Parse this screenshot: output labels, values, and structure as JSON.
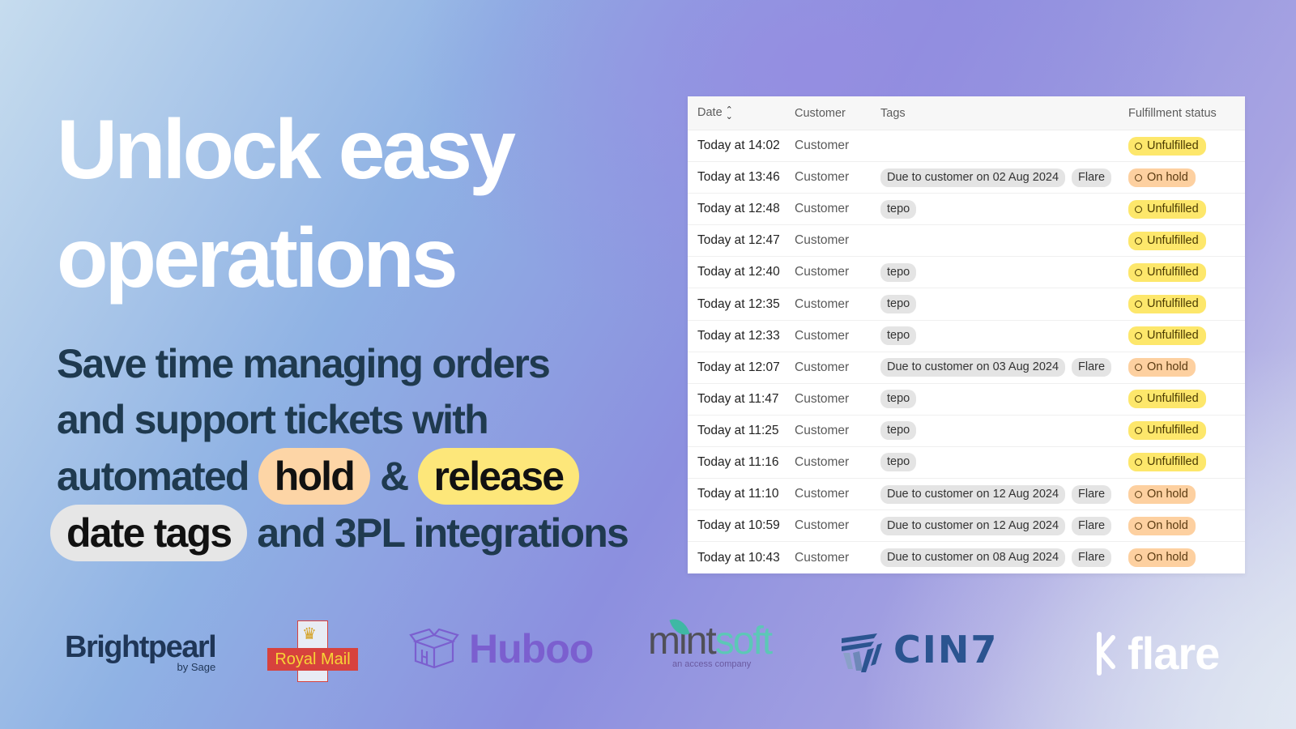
{
  "hero": {
    "title_line1": "Unlock easy",
    "title_line2": "operations"
  },
  "subtitle": {
    "line1": "Save time managing orders",
    "line2": "and support tickets with",
    "automated": "automated",
    "hold": "hold",
    "amp": "&",
    "release": "release",
    "date_tags": "date tags",
    "rest": "and 3PL integrations"
  },
  "table": {
    "headers": {
      "date": "Date",
      "customer": "Customer",
      "tags": "Tags",
      "status": "Fulfillment status"
    },
    "rows": [
      {
        "date": "Today at 14:02",
        "customer": "Customer",
        "tags": [],
        "status": "Unfulfilled"
      },
      {
        "date": "Today at 13:46",
        "customer": "Customer",
        "tags": [
          "Due to customer on 02 Aug 2024",
          "Flare"
        ],
        "status": "On hold"
      },
      {
        "date": "Today at 12:48",
        "customer": "Customer",
        "tags": [
          "tepo"
        ],
        "status": "Unfulfilled"
      },
      {
        "date": "Today at 12:47",
        "customer": "Customer",
        "tags": [],
        "status": "Unfulfilled"
      },
      {
        "date": "Today at 12:40",
        "customer": "Customer",
        "tags": [
          "tepo"
        ],
        "status": "Unfulfilled"
      },
      {
        "date": "Today at 12:35",
        "customer": "Customer",
        "tags": [
          "tepo"
        ],
        "status": "Unfulfilled"
      },
      {
        "date": "Today at 12:33",
        "customer": "Customer",
        "tags": [
          "tepo"
        ],
        "status": "Unfulfilled"
      },
      {
        "date": "Today at 12:07",
        "customer": "Customer",
        "tags": [
          "Due to customer on 03 Aug 2024",
          "Flare"
        ],
        "status": "On hold"
      },
      {
        "date": "Today at 11:47",
        "customer": "Customer",
        "tags": [
          "tepo"
        ],
        "status": "Unfulfilled"
      },
      {
        "date": "Today at 11:25",
        "customer": "Customer",
        "tags": [
          "tepo"
        ],
        "status": "Unfulfilled"
      },
      {
        "date": "Today at 11:16",
        "customer": "Customer",
        "tags": [
          "tepo"
        ],
        "status": "Unfulfilled"
      },
      {
        "date": "Today at 11:10",
        "customer": "Customer",
        "tags": [
          "Due to customer on 12 Aug 2024",
          "Flare"
        ],
        "status": "On hold"
      },
      {
        "date": "Today at 10:59",
        "customer": "Customer",
        "tags": [
          "Due to customer on 12 Aug 2024",
          "Flare"
        ],
        "status": "On hold"
      },
      {
        "date": "Today at 10:43",
        "customer": "Customer",
        "tags": [
          "Due to customer on 08 Aug 2024",
          "Flare"
        ],
        "status": "On hold"
      }
    ]
  },
  "status_colors": {
    "Unfulfilled": "#fde76b",
    "On hold": "#fdd0a0"
  },
  "logos": {
    "brightpearl": "Brightpearl",
    "brightpearl_sub": "by Sage",
    "royalmail": "Royal Mail",
    "huboo": "Huboo",
    "mintsoft_a": "mint",
    "mintsoft_b": "soft",
    "mintsoft_sub": "an access company",
    "cin7": "CIN7",
    "flare": "flare"
  }
}
